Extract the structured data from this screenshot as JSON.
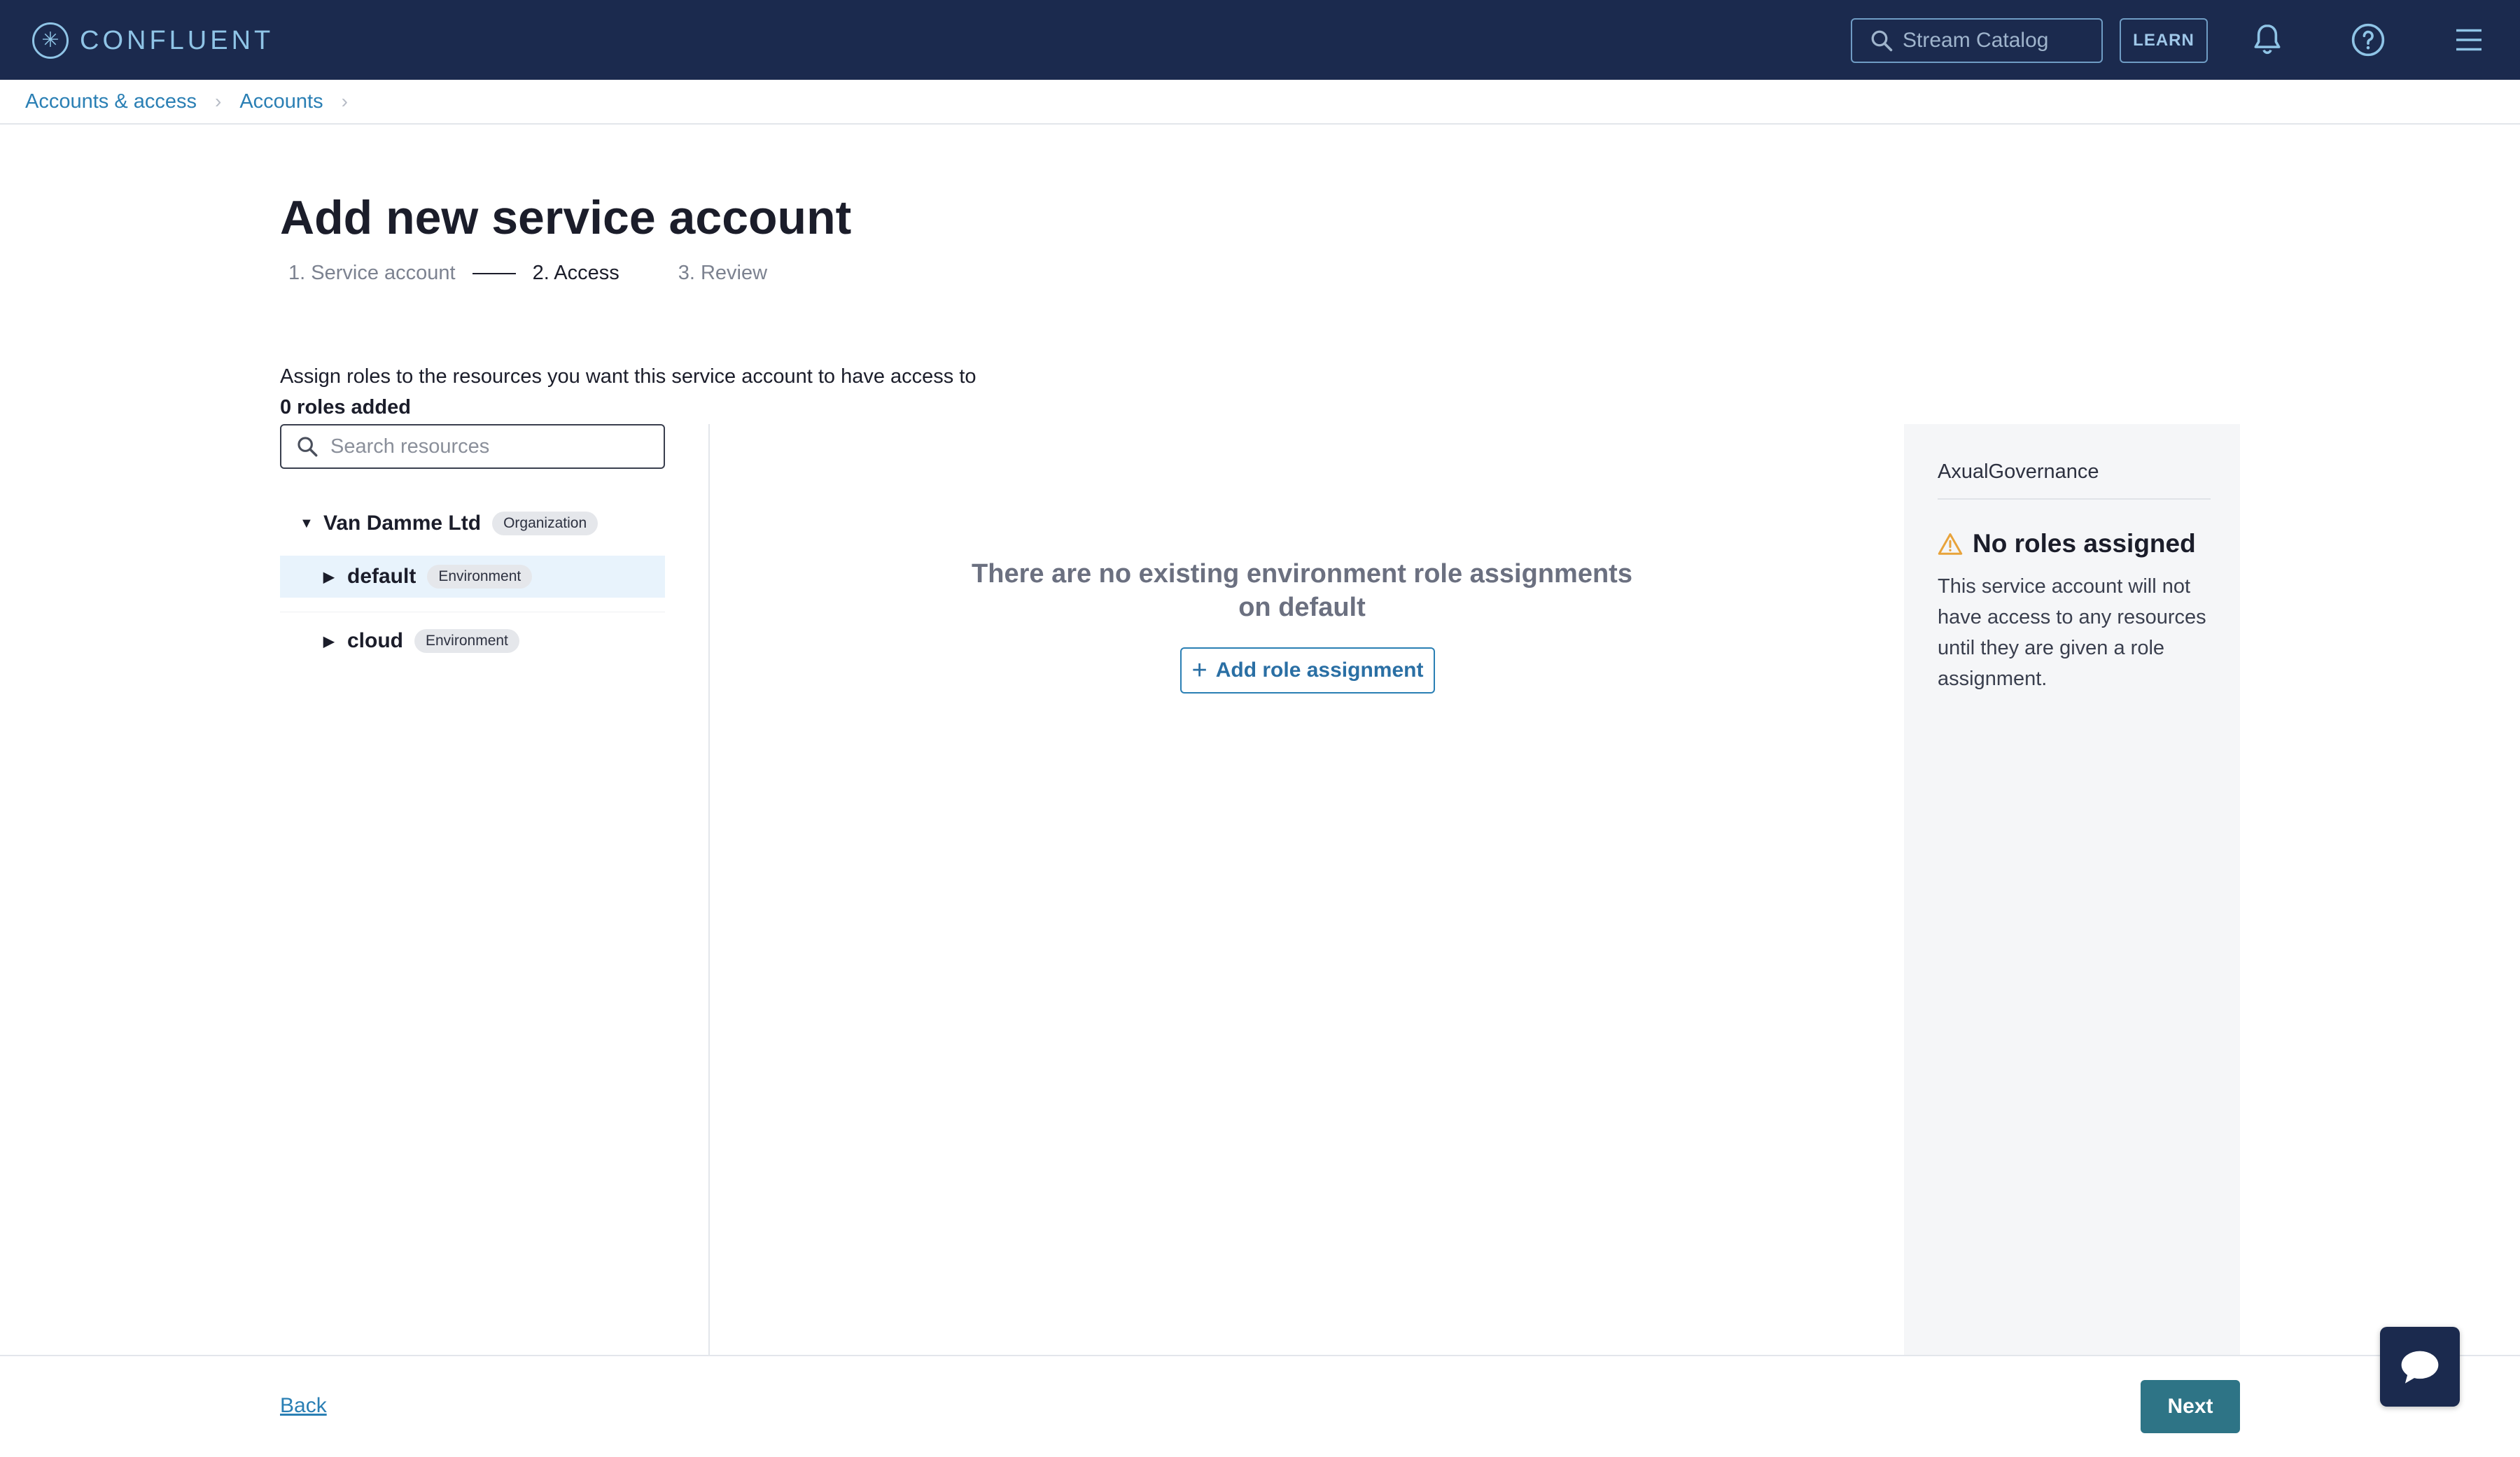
{
  "colors": {
    "topbar": "#1b2a4e",
    "accent": "#2a7fb4",
    "primary_button": "#2e7486",
    "warning": "#e8a33b"
  },
  "header": {
    "brand": "CONFLUENT",
    "search_placeholder": "Stream Catalog",
    "learn_label": "LEARN",
    "icons": [
      "bell-icon",
      "help-icon",
      "menu-icon"
    ]
  },
  "breadcrumb": {
    "items": [
      {
        "label": "Accounts & access"
      },
      {
        "label": "Accounts"
      }
    ]
  },
  "page": {
    "title": "Add new service account",
    "steps": [
      {
        "label": "1. Service account",
        "state": "done"
      },
      {
        "label": "2. Access",
        "state": "active"
      },
      {
        "label": "3. Review",
        "state": "upcoming"
      }
    ],
    "instruction": "Assign roles to the resources you want this service account to have access to",
    "roles_added": "0 roles added"
  },
  "resources": {
    "search_placeholder": "Search resources",
    "tree": {
      "org": {
        "name": "Van Damme Ltd",
        "tag": "Organization"
      },
      "environments": [
        {
          "name": "default",
          "tag": "Environment",
          "selected": true
        },
        {
          "name": "cloud",
          "tag": "Environment",
          "selected": false
        }
      ]
    }
  },
  "main": {
    "empty_message": "There are no existing environment role assignments on default",
    "add_role_label": "Add role assignment"
  },
  "summary": {
    "account_name": "AxualGovernance",
    "title": "No roles assigned",
    "description": "This service account will not have access to any resources until they are given a role assignment."
  },
  "footer": {
    "back_label": "Back",
    "next_label": "Next"
  }
}
